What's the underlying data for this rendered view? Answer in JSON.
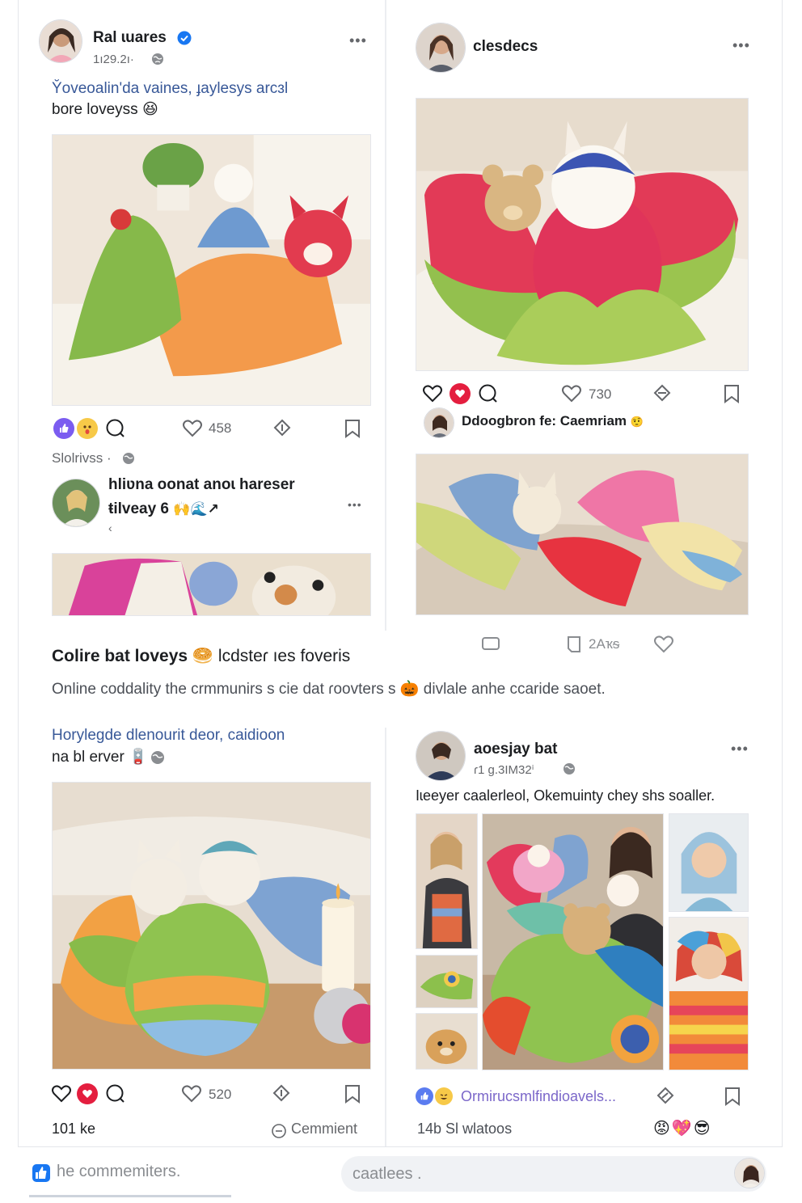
{
  "post1": {
    "author": "Ral ɩuares",
    "meta": "1ı29.2ı·",
    "text_line1": "Y̆oveoalin'da vaines, ɟaylesys arcɜl",
    "text_line2": "bore loveyss",
    "emoji": "😆",
    "likes": "458",
    "subinfo": "Slolrivss ·"
  },
  "post1_comment": {
    "line1": "hliʋna oonat anoɩ hareser",
    "line2": "ŧilveay 6",
    "reaction_marks": "🙌🌊↗",
    "reply_glyph": "‹"
  },
  "post2": {
    "author": "clesdecs",
    "likes": "730",
    "tagline": "Ddoogbron fe: Caemriam",
    "tag_emoji": "🤨",
    "shares": "2Aҡᵴ"
  },
  "section": {
    "headline": "Colire bat loveys",
    "headline_emoji": "🥯",
    "headline_rest": "lcdsteɾ ıes foveris",
    "desc": "Online coddality the crmmunirs s cie dat ɾoovters s",
    "desc_emoji": "🎃",
    "desc_rest": "divlale anhe ccaride saoet."
  },
  "post3": {
    "text_line1": "Horylegde dlenourit deor, caidioon",
    "text_line2": "na bl erver",
    "text_emoji": "🪫",
    "likes": "520",
    "like_count_label": "101 ke",
    "comment_label": "Cemmient"
  },
  "post4": {
    "author": "aoesjay bat",
    "meta": "ɾ1 g.3IM32ⁱ",
    "text": "Iɩeeyer caalerleol, Okemuinty chey shs soaller.",
    "reaction_label": "Ormirucsmlfindioavels...",
    "count_label": "14b Sl wlatoos",
    "footer_emojis": "😡💖😎"
  },
  "bottom": {
    "comment_placeholder": "he commemiters.",
    "search_placeholder": "caatlees ."
  },
  "colors": {
    "accent_blue": "#1877f2",
    "like_red": "#e41e3f",
    "text_dark": "#1c1e21",
    "meta_gray": "#65676b"
  },
  "icons": [
    "verified-badge-icon",
    "globe-icon",
    "heart-icon",
    "comment-icon",
    "share-icon",
    "bookmark-icon",
    "more-dots-icon"
  ]
}
